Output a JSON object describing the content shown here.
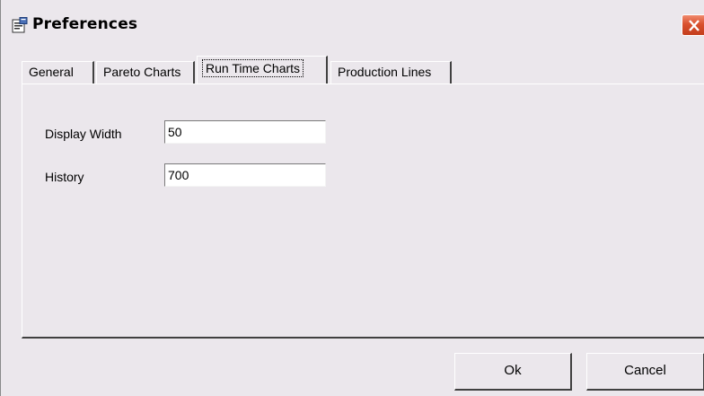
{
  "window": {
    "title": "Preferences",
    "icon": "preferences-window-icon",
    "close_icon": "close-icon",
    "close_color": "#d9512e"
  },
  "tabs": [
    {
      "label": "General",
      "active": false
    },
    {
      "label": "Pareto Charts",
      "active": false
    },
    {
      "label": "Run Time Charts",
      "active": true
    },
    {
      "label": "Production Lines",
      "active": false
    }
  ],
  "form": {
    "display_width": {
      "label": "Display Width",
      "value": "50"
    },
    "history": {
      "label": "History",
      "value": "700"
    }
  },
  "buttons": {
    "ok": "Ok",
    "cancel": "Cancel"
  }
}
